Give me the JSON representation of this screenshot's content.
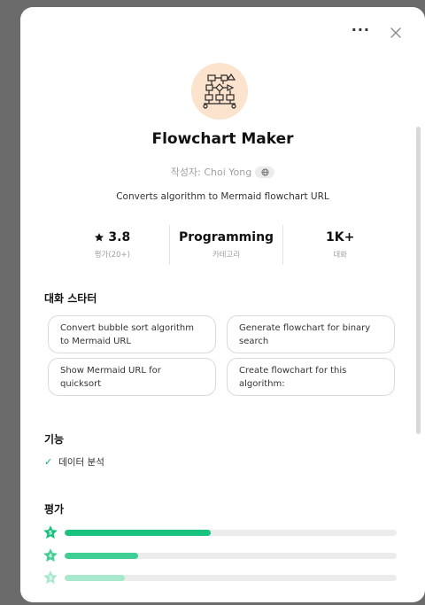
{
  "header": {
    "more_label": "···"
  },
  "gpt": {
    "title": "Flowchart Maker",
    "author": "작성자: Choi Yong",
    "description": "Converts algorithm to Mermaid flowchart URL"
  },
  "stats": [
    {
      "value": "3.8",
      "label": "평가(20+)",
      "icon": "star-icon"
    },
    {
      "value": "Programming",
      "label": "카테고리"
    },
    {
      "value": "1K+",
      "label": "대화"
    }
  ],
  "starters": {
    "title": "대화 스타터",
    "items": [
      "Convert bubble sort algorithm to Mermaid URL",
      "Generate flowchart for binary search",
      "Show Mermaid URL for quicksort",
      "Create flowchart for this algorithm:"
    ]
  },
  "features": {
    "title": "기능",
    "items": [
      "데이터 분석"
    ]
  },
  "ratings": {
    "title": "평가",
    "rows": [
      {
        "stars": "5",
        "fraction": 0.44,
        "color": "#19c37d"
      },
      {
        "stars": "4",
        "fraction": 0.22,
        "color": "#3fcf95"
      },
      {
        "stars": "3",
        "fraction": 0.18,
        "color": "#a8e8cc"
      }
    ]
  },
  "colors": {
    "accent": "#19c37d",
    "logo_bg": "#fbe3cd"
  }
}
